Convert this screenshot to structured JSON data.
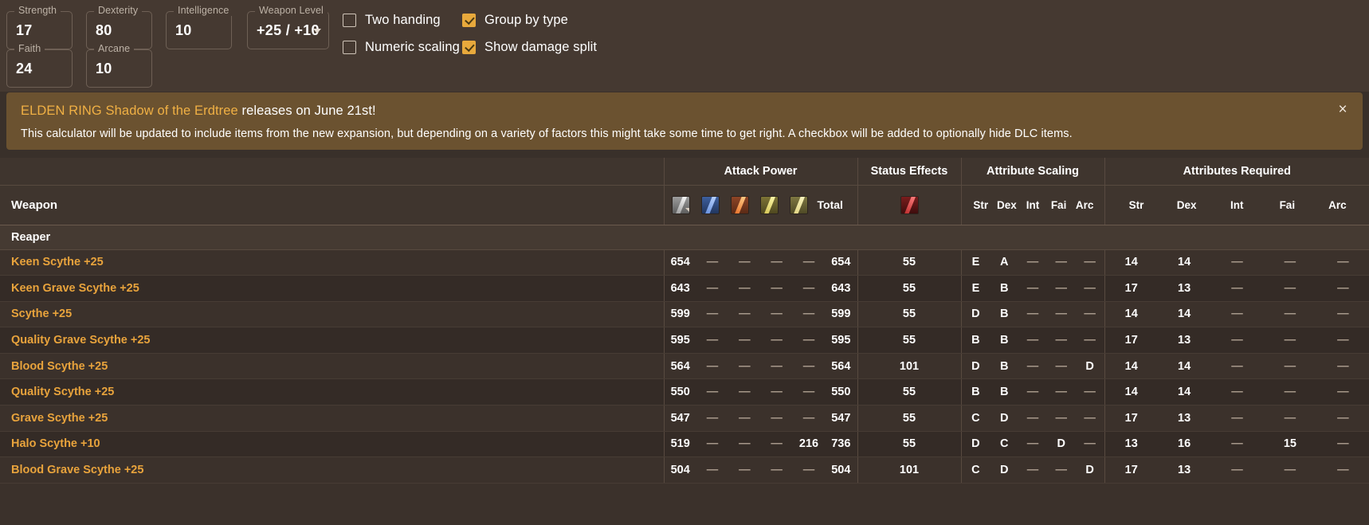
{
  "attributes": [
    {
      "label": "Strength",
      "value": "17"
    },
    {
      "label": "Dexterity",
      "value": "80"
    },
    {
      "label": "Intelligence",
      "value": "10"
    },
    {
      "label": "Weapon Level",
      "value": "+25 / +10"
    },
    {
      "label": "Faith",
      "value": "24"
    },
    {
      "label": "Arcane",
      "value": "10"
    }
  ],
  "checkboxes": [
    {
      "label": "Two handing",
      "checked": false
    },
    {
      "label": "Numeric scaling",
      "checked": false
    },
    {
      "label": "Group by type",
      "checked": true
    },
    {
      "label": "Show damage split",
      "checked": true
    }
  ],
  "banner": {
    "highlight": "ELDEN RING Shadow of the Erdtree",
    "headline_rest": " releases on June 21st!",
    "body": "This calculator will be updated to include items from the new expansion, but depending on a variety of factors this might take some time to get right. A checkbox will be added to optionally hide DLC items.",
    "close_label": "×",
    "highlight_color": "#f0b044",
    "background_color": "#6b5230"
  },
  "table": {
    "group_headers": {
      "weapon": "",
      "attack_power": "Attack Power",
      "status_effects": "Status Effects",
      "attribute_scaling": "Attribute Scaling",
      "attributes_required": "Attributes Required"
    },
    "sub_headers": {
      "weapon": "Weapon",
      "total": "Total",
      "damage_icons": [
        "physical-icon",
        "magic-icon",
        "fire-icon",
        "lightning-icon",
        "holy-icon"
      ],
      "status_icons": [
        "bleed-icon"
      ],
      "scaling_attrs": [
        "Str",
        "Dex",
        "Int",
        "Fai",
        "Arc"
      ],
      "required_attrs": [
        "Str",
        "Dex",
        "Int",
        "Fai",
        "Arc"
      ]
    },
    "group_label": "Reaper",
    "rows": [
      {
        "name": "Keen Scythe +25",
        "dmg": [
          "654",
          "—",
          "—",
          "—",
          "—"
        ],
        "total": "654",
        "status": "55",
        "scaling": [
          "E",
          "A",
          "—",
          "—",
          "—"
        ],
        "required": [
          "14",
          "14",
          "—",
          "—",
          "—"
        ]
      },
      {
        "name": "Keen Grave Scythe +25",
        "dmg": [
          "643",
          "—",
          "—",
          "—",
          "—"
        ],
        "total": "643",
        "status": "55",
        "scaling": [
          "E",
          "B",
          "—",
          "—",
          "—"
        ],
        "required": [
          "17",
          "13",
          "—",
          "—",
          "—"
        ]
      },
      {
        "name": "Scythe +25",
        "dmg": [
          "599",
          "—",
          "—",
          "—",
          "—"
        ],
        "total": "599",
        "status": "55",
        "scaling": [
          "D",
          "B",
          "—",
          "—",
          "—"
        ],
        "required": [
          "14",
          "14",
          "—",
          "—",
          "—"
        ]
      },
      {
        "name": "Quality Grave Scythe +25",
        "dmg": [
          "595",
          "—",
          "—",
          "—",
          "—"
        ],
        "total": "595",
        "status": "55",
        "scaling": [
          "B",
          "B",
          "—",
          "—",
          "—"
        ],
        "required": [
          "17",
          "13",
          "—",
          "—",
          "—"
        ]
      },
      {
        "name": "Blood Scythe +25",
        "dmg": [
          "564",
          "—",
          "—",
          "—",
          "—"
        ],
        "total": "564",
        "status": "101",
        "scaling": [
          "D",
          "B",
          "—",
          "—",
          "D"
        ],
        "required": [
          "14",
          "14",
          "—",
          "—",
          "—"
        ]
      },
      {
        "name": "Quality Scythe +25",
        "dmg": [
          "550",
          "—",
          "—",
          "—",
          "—"
        ],
        "total": "550",
        "status": "55",
        "scaling": [
          "B",
          "B",
          "—",
          "—",
          "—"
        ],
        "required": [
          "14",
          "14",
          "—",
          "—",
          "—"
        ]
      },
      {
        "name": "Grave Scythe +25",
        "dmg": [
          "547",
          "—",
          "—",
          "—",
          "—"
        ],
        "total": "547",
        "status": "55",
        "scaling": [
          "C",
          "D",
          "—",
          "—",
          "—"
        ],
        "required": [
          "17",
          "13",
          "—",
          "—",
          "—"
        ]
      },
      {
        "name": "Halo Scythe +10",
        "dmg": [
          "519",
          "—",
          "—",
          "—",
          "216"
        ],
        "total": "736",
        "status": "55",
        "scaling": [
          "D",
          "C",
          "—",
          "D",
          "—"
        ],
        "required": [
          "13",
          "16",
          "—",
          "15",
          "—"
        ]
      },
      {
        "name": "Blood Grave Scythe +25",
        "dmg": [
          "504",
          "—",
          "—",
          "—",
          "—"
        ],
        "total": "504",
        "status": "101",
        "scaling": [
          "C",
          "D",
          "—",
          "—",
          "D"
        ],
        "required": [
          "17",
          "13",
          "—",
          "—",
          "—"
        ]
      }
    ]
  }
}
